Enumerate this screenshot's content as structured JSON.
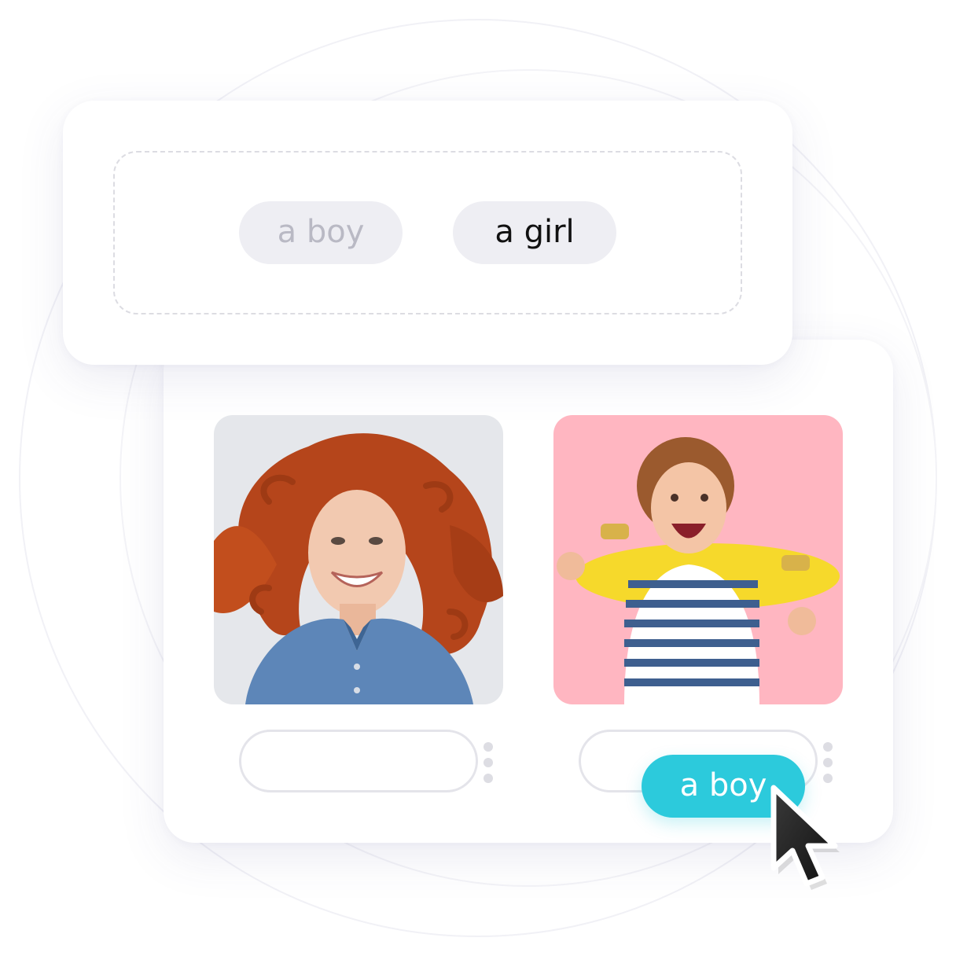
{
  "word_bank": {
    "chips": [
      {
        "label": "a boy",
        "state": "used"
      },
      {
        "label": "a girl",
        "state": "available"
      }
    ]
  },
  "task": {
    "images": [
      {
        "subject": "smiling woman with red curly hair in denim shirt",
        "answer": ""
      },
      {
        "subject": "laughing boy in striped shirt holding yellow skateboard",
        "answer": ""
      }
    ],
    "dragging_chip": {
      "label": "a boy"
    }
  },
  "colors": {
    "accent": "#2ccadc",
    "chip_bg": "#eeeef3",
    "chip_used_text": "#b9b9c4",
    "pink_bg": "#ffb6c1",
    "grey_bg": "#e4e6ea"
  },
  "icons": [
    "pointer-cursor-icon",
    "drag-handle-icon"
  ]
}
